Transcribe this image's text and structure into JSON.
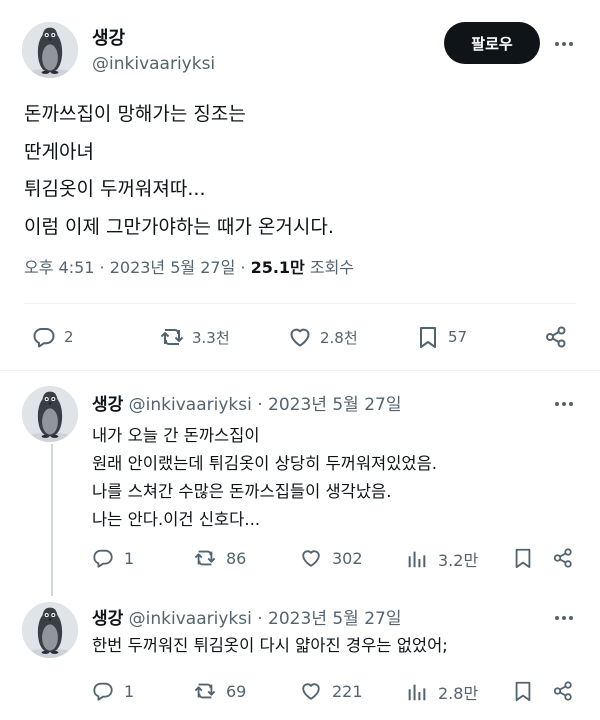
{
  "tweet": {
    "author_name": "생강",
    "author_handle": "@inkivaariyksi",
    "follow_label": "팔로우",
    "lines": [
      "돈까쓰집이 망해가는 징조는",
      "딴게아녀",
      "튀김옷이 두꺼워져따...",
      "이럼 이제 그만가야하는 때가 온거시다."
    ],
    "time": "오후 4:51 · 2023년 5월 27일 · ",
    "views": "25.1만",
    "views_label": " 조회수",
    "replies": "2",
    "retweets": "3.3천",
    "likes": "2.8천",
    "bookmarks": "57"
  },
  "replies": [
    {
      "name": "생강",
      "handle_date": " @inkivaariyksi · 2023년 5월 27일",
      "lines": [
        "내가 오늘 간 돈까스집이",
        "원래 안이랬는데 튀김옷이 상당히 두꺼워져있었음.",
        "나를 스쳐간 수많은 돈까스집들이 생각났음.",
        "나는 안다.이건 신호다..."
      ],
      "replies": "1",
      "retweets": "86",
      "likes": "302",
      "views": "3.2만"
    },
    {
      "name": "생강",
      "handle_date": " @inkivaariyksi · 2023년 5월 27일",
      "lines": [
        "한번 두꺼워진 튀김옷이 다시 얇아진 경우는 없었어;"
      ],
      "replies": "1",
      "retweets": "69",
      "likes": "221",
      "views": "2.8만"
    }
  ],
  "icons": {
    "reply": "reply-icon",
    "retweet": "retweet-icon",
    "like": "heart-icon",
    "bookmark": "bookmark-icon",
    "share": "share-icon",
    "views": "views-icon",
    "more": "more-icon"
  },
  "colors": {
    "text": "#0f1419",
    "secondary": "#536471",
    "button": "#0f1419",
    "divider": "#eff3f4"
  }
}
